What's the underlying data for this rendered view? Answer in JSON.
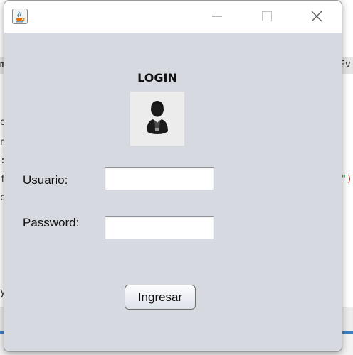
{
  "background_editor": {
    "fragments": [
      {
        "id": "top-left",
        "text": "m"
      },
      {
        "id": "top-right",
        "text": "Ev"
      },
      {
        "id": "l1",
        "text": "o"
      },
      {
        "id": "l2",
        "text": "n"
      },
      {
        "id": "l3",
        "text": ":"
      },
      {
        "id": "l4",
        "text": "f"
      },
      {
        "id": "l5",
        "text": "o"
      },
      {
        "id": "right-paren",
        "text": "\")"
      },
      {
        "id": "l6",
        "text": "y"
      }
    ]
  },
  "window": {
    "title_icon": "java-coffee-icon",
    "controls": {
      "minimize_icon": "minimize-icon",
      "maximize_icon": "maximize-icon",
      "close_icon": "close-icon"
    }
  },
  "form": {
    "title": "LOGIN",
    "user_image_icon": "user-silhouette-icon",
    "username_label": "Usuario:",
    "username_value": "",
    "password_label": "Password:",
    "password_value": "",
    "submit_label": "Ingresar"
  },
  "colors": {
    "window_background": "#d6d9e0",
    "titlebar_background": "#ffffff",
    "editor_selection_bar": "#e6e6e6",
    "accent_blue": "#3d7fc4",
    "string_green": "#2e9a3a",
    "paren_red": "#c0392b"
  }
}
